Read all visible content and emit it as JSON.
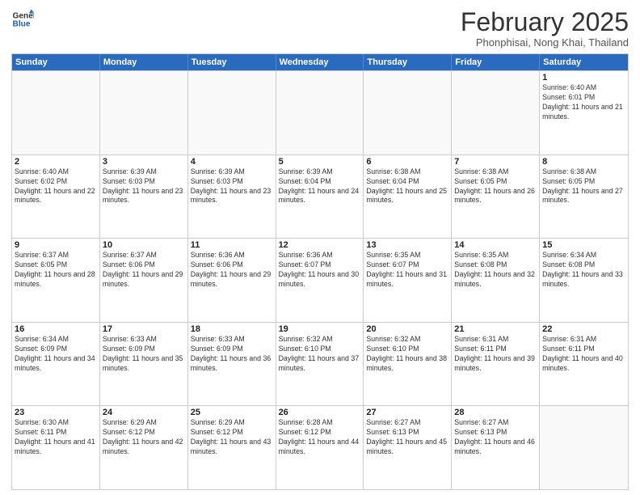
{
  "header": {
    "logo_line1": "General",
    "logo_line2": "Blue",
    "month_title": "February 2025",
    "location": "Phonphisai, Nong Khai, Thailand"
  },
  "weekdays": [
    "Sunday",
    "Monday",
    "Tuesday",
    "Wednesday",
    "Thursday",
    "Friday",
    "Saturday"
  ],
  "weeks": [
    [
      {
        "day": "",
        "sunrise": "",
        "sunset": "",
        "daylight": ""
      },
      {
        "day": "",
        "sunrise": "",
        "sunset": "",
        "daylight": ""
      },
      {
        "day": "",
        "sunrise": "",
        "sunset": "",
        "daylight": ""
      },
      {
        "day": "",
        "sunrise": "",
        "sunset": "",
        "daylight": ""
      },
      {
        "day": "",
        "sunrise": "",
        "sunset": "",
        "daylight": ""
      },
      {
        "day": "",
        "sunrise": "",
        "sunset": "",
        "daylight": ""
      },
      {
        "day": "1",
        "sunrise": "Sunrise: 6:40 AM",
        "sunset": "Sunset: 6:01 PM",
        "daylight": "Daylight: 11 hours and 21 minutes."
      }
    ],
    [
      {
        "day": "2",
        "sunrise": "Sunrise: 6:40 AM",
        "sunset": "Sunset: 6:02 PM",
        "daylight": "Daylight: 11 hours and 22 minutes."
      },
      {
        "day": "3",
        "sunrise": "Sunrise: 6:39 AM",
        "sunset": "Sunset: 6:03 PM",
        "daylight": "Daylight: 11 hours and 23 minutes."
      },
      {
        "day": "4",
        "sunrise": "Sunrise: 6:39 AM",
        "sunset": "Sunset: 6:03 PM",
        "daylight": "Daylight: 11 hours and 23 minutes."
      },
      {
        "day": "5",
        "sunrise": "Sunrise: 6:39 AM",
        "sunset": "Sunset: 6:04 PM",
        "daylight": "Daylight: 11 hours and 24 minutes."
      },
      {
        "day": "6",
        "sunrise": "Sunrise: 6:38 AM",
        "sunset": "Sunset: 6:04 PM",
        "daylight": "Daylight: 11 hours and 25 minutes."
      },
      {
        "day": "7",
        "sunrise": "Sunrise: 6:38 AM",
        "sunset": "Sunset: 6:05 PM",
        "daylight": "Daylight: 11 hours and 26 minutes."
      },
      {
        "day": "8",
        "sunrise": "Sunrise: 6:38 AM",
        "sunset": "Sunset: 6:05 PM",
        "daylight": "Daylight: 11 hours and 27 minutes."
      }
    ],
    [
      {
        "day": "9",
        "sunrise": "Sunrise: 6:37 AM",
        "sunset": "Sunset: 6:05 PM",
        "daylight": "Daylight: 11 hours and 28 minutes."
      },
      {
        "day": "10",
        "sunrise": "Sunrise: 6:37 AM",
        "sunset": "Sunset: 6:06 PM",
        "daylight": "Daylight: 11 hours and 29 minutes."
      },
      {
        "day": "11",
        "sunrise": "Sunrise: 6:36 AM",
        "sunset": "Sunset: 6:06 PM",
        "daylight": "Daylight: 11 hours and 29 minutes."
      },
      {
        "day": "12",
        "sunrise": "Sunrise: 6:36 AM",
        "sunset": "Sunset: 6:07 PM",
        "daylight": "Daylight: 11 hours and 30 minutes."
      },
      {
        "day": "13",
        "sunrise": "Sunrise: 6:35 AM",
        "sunset": "Sunset: 6:07 PM",
        "daylight": "Daylight: 11 hours and 31 minutes."
      },
      {
        "day": "14",
        "sunrise": "Sunrise: 6:35 AM",
        "sunset": "Sunset: 6:08 PM",
        "daylight": "Daylight: 11 hours and 32 minutes."
      },
      {
        "day": "15",
        "sunrise": "Sunrise: 6:34 AM",
        "sunset": "Sunset: 6:08 PM",
        "daylight": "Daylight: 11 hours and 33 minutes."
      }
    ],
    [
      {
        "day": "16",
        "sunrise": "Sunrise: 6:34 AM",
        "sunset": "Sunset: 6:09 PM",
        "daylight": "Daylight: 11 hours and 34 minutes."
      },
      {
        "day": "17",
        "sunrise": "Sunrise: 6:33 AM",
        "sunset": "Sunset: 6:09 PM",
        "daylight": "Daylight: 11 hours and 35 minutes."
      },
      {
        "day": "18",
        "sunrise": "Sunrise: 6:33 AM",
        "sunset": "Sunset: 6:09 PM",
        "daylight": "Daylight: 11 hours and 36 minutes."
      },
      {
        "day": "19",
        "sunrise": "Sunrise: 6:32 AM",
        "sunset": "Sunset: 6:10 PM",
        "daylight": "Daylight: 11 hours and 37 minutes."
      },
      {
        "day": "20",
        "sunrise": "Sunrise: 6:32 AM",
        "sunset": "Sunset: 6:10 PM",
        "daylight": "Daylight: 11 hours and 38 minutes."
      },
      {
        "day": "21",
        "sunrise": "Sunrise: 6:31 AM",
        "sunset": "Sunset: 6:11 PM",
        "daylight": "Daylight: 11 hours and 39 minutes."
      },
      {
        "day": "22",
        "sunrise": "Sunrise: 6:31 AM",
        "sunset": "Sunset: 6:11 PM",
        "daylight": "Daylight: 11 hours and 40 minutes."
      }
    ],
    [
      {
        "day": "23",
        "sunrise": "Sunrise: 6:30 AM",
        "sunset": "Sunset: 6:11 PM",
        "daylight": "Daylight: 11 hours and 41 minutes."
      },
      {
        "day": "24",
        "sunrise": "Sunrise: 6:29 AM",
        "sunset": "Sunset: 6:12 PM",
        "daylight": "Daylight: 11 hours and 42 minutes."
      },
      {
        "day": "25",
        "sunrise": "Sunrise: 6:29 AM",
        "sunset": "Sunset: 6:12 PM",
        "daylight": "Daylight: 11 hours and 43 minutes."
      },
      {
        "day": "26",
        "sunrise": "Sunrise: 6:28 AM",
        "sunset": "Sunset: 6:12 PM",
        "daylight": "Daylight: 11 hours and 44 minutes."
      },
      {
        "day": "27",
        "sunrise": "Sunrise: 6:27 AM",
        "sunset": "Sunset: 6:13 PM",
        "daylight": "Daylight: 11 hours and 45 minutes."
      },
      {
        "day": "28",
        "sunrise": "Sunrise: 6:27 AM",
        "sunset": "Sunset: 6:13 PM",
        "daylight": "Daylight: 11 hours and 46 minutes."
      },
      {
        "day": "",
        "sunrise": "",
        "sunset": "",
        "daylight": ""
      }
    ]
  ]
}
